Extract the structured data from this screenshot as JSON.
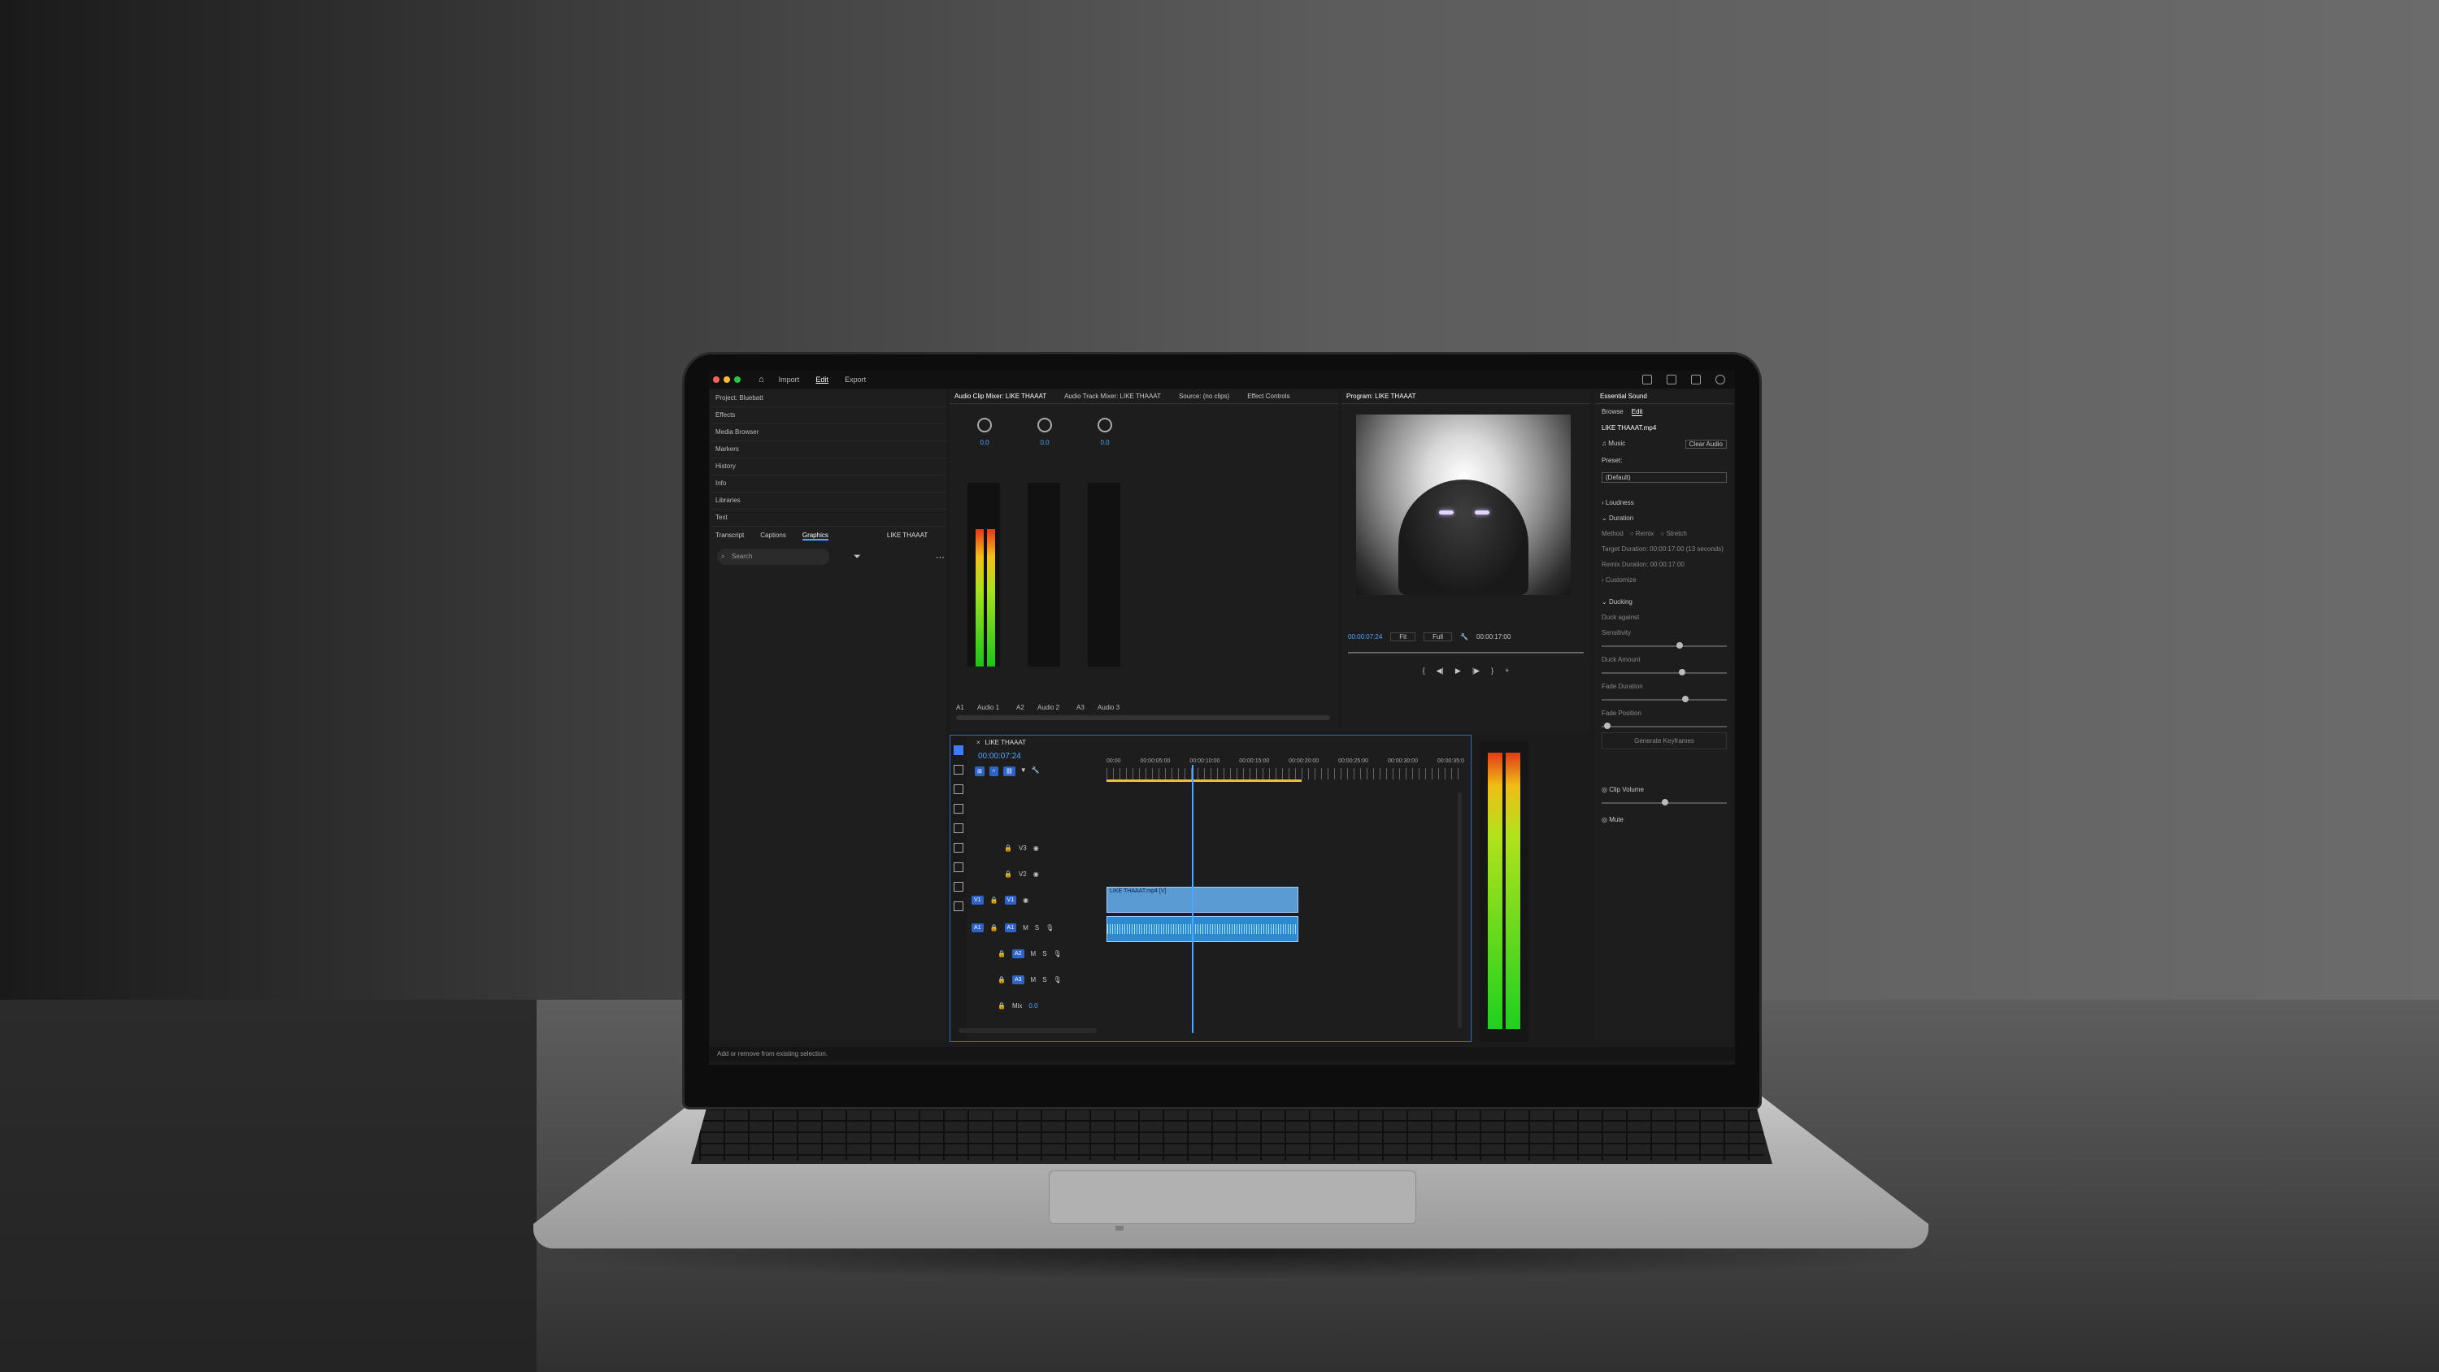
{
  "app": {
    "menu": [
      "Import",
      "Edit",
      "Export"
    ],
    "active_menu": "Edit",
    "status": "Add or remove from existing selection."
  },
  "left_panel": {
    "items": [
      "Project: Bluebatt",
      "Effects",
      "Media Browser",
      "Markers",
      "History",
      "Info",
      "Libraries",
      "Text"
    ],
    "tabs": [
      "Transcript",
      "Captions",
      "Graphics"
    ],
    "selected_tab": "Graphics",
    "sequence_label": "LIKE THAAAT",
    "search_placeholder": "Search"
  },
  "mixer": {
    "tabs": [
      "Audio Clip Mixer: LIKE THAAAT",
      "Audio Track Mixer: LIKE THAAAT",
      "Source: (no clips)",
      "Effect Controls"
    ],
    "strips": [
      {
        "id": "A1",
        "name": "Audio 1",
        "value": "0.0",
        "level": 0.75
      },
      {
        "id": "A2",
        "name": "Audio 2",
        "value": "0.0",
        "level": 0.0
      },
      {
        "id": "A3",
        "name": "Audio 3",
        "value": "0.0",
        "level": 0.0
      }
    ]
  },
  "program": {
    "title": "Program: LIKE THAAAT",
    "timecode": "00:00:07:24",
    "fit": "Fit",
    "quality": "Full",
    "duration": "00:00:17:00"
  },
  "essential_sound": {
    "title": "Essential Sound",
    "tabs": [
      "Browse",
      "Edit"
    ],
    "clip": "LIKE THAAAT.mp4",
    "type": "Music",
    "clear_label": "Clear Audio",
    "preset_label": "Preset:",
    "preset_value": "(Default)",
    "sections": [
      "Loudness",
      "Duration",
      "Ducking"
    ],
    "duration": {
      "method_label": "Method",
      "options": [
        "Remix",
        "Stretch"
      ],
      "target": "Target Duration: 00:00:17:00",
      "target_note": "(13 seconds)",
      "remix": "Remix Duration: 00:00:17:00",
      "customize": "Customize"
    },
    "ducking": {
      "duck_against": "Duck against",
      "sliders": [
        "Sensitivity",
        "Duck Amount",
        "Fade Duration",
        "Fade Position"
      ],
      "generate": "Generate Keyframes"
    },
    "clip_volume": "Clip Volume",
    "mute": "Mute"
  },
  "timeline": {
    "title": "LIKE THAAAT",
    "timecode": "00:00:07:24",
    "ruler": [
      "00:00",
      "00:00:05:00",
      "00:00:10:00",
      "00:00:15:00",
      "00:00:20:00",
      "00:00:25:00",
      "00:00:30:00",
      "00:00:35:0"
    ],
    "tracks": [
      "V3",
      "V2",
      "V1",
      "A1",
      "A2",
      "A3",
      "Mix"
    ],
    "mix_value": "0.0",
    "video_clip": "LIKE THAAAT.mp4 [V]"
  },
  "colors": {
    "accent": "#4ea6ff",
    "selection": "#2f6ad0",
    "clip_video": "#5a9bd4",
    "clip_audio": "#2d8ad0"
  }
}
